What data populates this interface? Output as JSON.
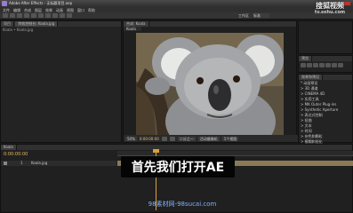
{
  "app": {
    "title": "Adobe After Effects - 无标题项目.aep",
    "menu": [
      "文件",
      "编辑",
      "合成",
      "图层",
      "效果",
      "动画",
      "视图",
      "窗口",
      "帮助"
    ],
    "workspace": [
      "工作区",
      "标准"
    ]
  },
  "watermark": {
    "top": "搜狐视频",
    "top_sub": "tv.sohu.com",
    "bottom": "98素材网-98sucai.com"
  },
  "project_panel": {
    "tabs": [
      "项目",
      "特效控制台: Koala.jpg"
    ],
    "breadcrumb": "Koala • Koala.jpg"
  },
  "comp_panel": {
    "tab": "合成: Koala",
    "subtab": "Koala",
    "zoom": "50%",
    "timecode": "0:00:00:00",
    "quality": "二分之一",
    "camera": "活动摄像机",
    "view": "1个视图"
  },
  "right_panels": {
    "preview_tab": "预览",
    "effects_tab": "效果和预设",
    "effects_items": [
      "* 动画预设",
      "> 3D 通道",
      "> CINEMA 4D",
      "> 实用工具",
      "> MK Outer Plug-ins",
      "> Synthetic Aperture",
      "> 表达式控制",
      "> 扭曲",
      "> 文本",
      "> 时间",
      "> 杂色和颗粒",
      "> 模糊和锐化",
      "> 生成"
    ]
  },
  "timeline": {
    "tab": "Koala",
    "timecode": "0:00:00:00",
    "layer_name": "Koala.jpg",
    "layer_index": "1"
  },
  "subtitle": {
    "text": "首先我们打开AE"
  },
  "colors": {
    "accent": "#f0c050",
    "playhead": "#d9a13a",
    "layerbar": "#8a7b55"
  }
}
